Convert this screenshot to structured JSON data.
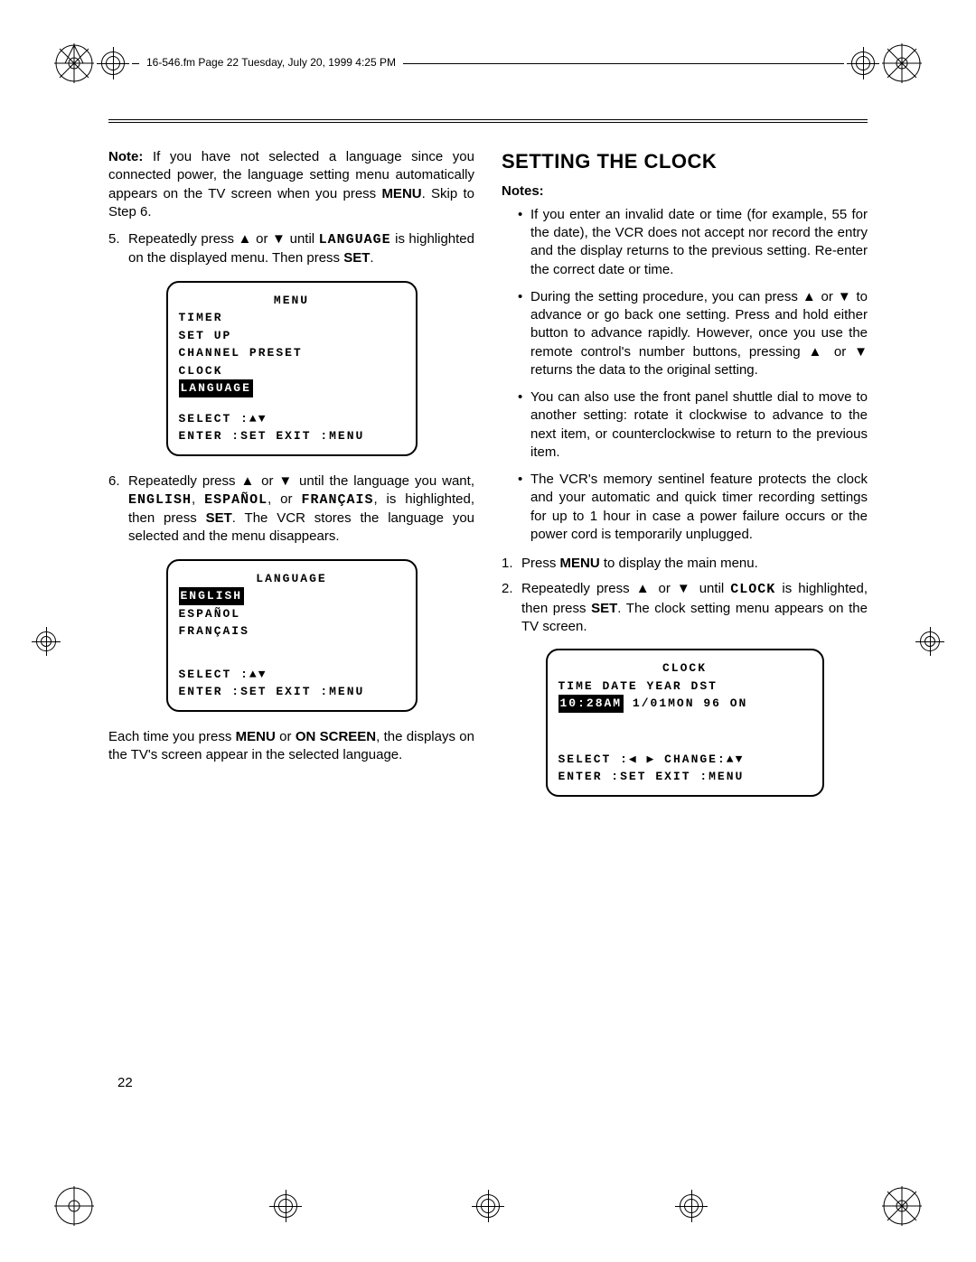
{
  "header_text": "16-546.fm  Page 22  Tuesday, July 20, 1999  4:25 PM",
  "page_number": "22",
  "left_col": {
    "note_prefix": "Note:",
    "note_body": " If you have not selected a language since you connected power, the language setting menu automatically appears on the TV screen when you press ",
    "note_menu": "MENU",
    "note_tail": ". Skip to Step 6.",
    "step5_num": "5.",
    "step5_a": "Repeatedly press ",
    "step5_arrows": "▲ or ▼",
    "step5_b": " until ",
    "step5_lang": "LANGUAGE",
    "step5_c": " is highlighted on the displayed menu. Then press ",
    "step5_set": "SET",
    "step5_d": ".",
    "menu1": {
      "title": "MENU",
      "items": [
        "TIMER",
        "SET UP",
        "CHANNEL PRESET",
        "CLOCK"
      ],
      "highlight": "LANGUAGE",
      "select": "SELECT :▲▼",
      "footer": "ENTER  :SET  EXIT  :MENU"
    },
    "step6_num": "6.",
    "step6_a": "Repeatedly press ",
    "step6_arrows": "▲ or ▼",
    "step6_b": " until the language you want, ",
    "step6_eng": "ENGLISH",
    "step6_sep1": ", ",
    "step6_esp": "ESPAÑOL",
    "step6_sep2": ", or ",
    "step6_fra": "FRANÇAIS",
    "step6_c": ", is highlighted, then press ",
    "step6_set": "SET",
    "step6_d": ". The VCR stores the language you selected and the menu disappears.",
    "menu2": {
      "title": "LANGUAGE",
      "highlight": "ENGLISH",
      "items": [
        "ESPAÑOL",
        "FRANÇAIS"
      ],
      "select": "SELECT :▲▼",
      "footer": "ENTER  :SET  EXIT  :MENU"
    },
    "closing_a": "Each time you press ",
    "closing_menu": "MENU",
    "closing_or": " or ",
    "closing_os": "ON SCREEN",
    "closing_b": ", the displays on the TV's screen appear in the selected language."
  },
  "right_col": {
    "heading": "SETTING THE CLOCK",
    "notes_label": "Notes:",
    "bullets": [
      "If you enter an invalid date or time (for example, 55 for the date), the VCR does not accept nor record the entry and the display returns to the previous setting. Re-enter the correct date or time.",
      "During the setting procedure, you can press ▲ or ▼ to advance or go back one setting. Press and hold either button to advance rapidly. However, once you use the remote control's number buttons, pressing ▲ or ▼ returns the data to the original setting.",
      "You can also use the front panel shuttle dial to move to another setting: rotate it clockwise to advance to the next item, or counterclockwise to return to the previous item.",
      "The VCR's memory sentinel feature protects the clock and your automatic and quick timer recording settings for up to 1 hour in case a power failure occurs or the power cord is temporarily unplugged."
    ],
    "step1_num": "1.",
    "step1_a": "Press ",
    "step1_menu": "MENU",
    "step1_b": " to display the main menu.",
    "step2_num": "2.",
    "step2_a": "Repeatedly press ",
    "step2_arrows": "▲ or ▼",
    "step2_b": " until ",
    "step2_clock": "CLOCK",
    "step2_c": " is highlighted, then press ",
    "step2_set": "SET",
    "step2_d": ". The clock setting menu appears on the TV screen.",
    "menu3": {
      "title": "CLOCK",
      "header_row": "TIME    DATE    YEAR DST",
      "highlight": "10:28AM",
      "data_tail": "  1/01MON 96  ON",
      "select": "SELECT :◀ ▶  CHANGE:▲▼",
      "footer": "ENTER  :SET  EXIT  :MENU"
    }
  }
}
